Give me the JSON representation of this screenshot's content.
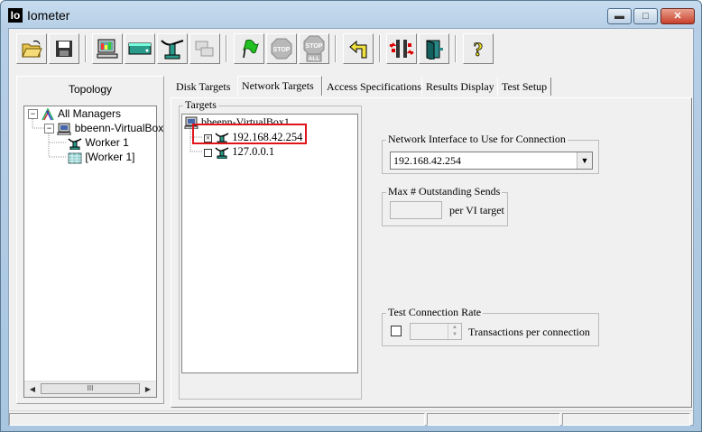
{
  "window": {
    "title": "Iometer",
    "icon_text": "Io",
    "controls": [
      "minimize",
      "maximize",
      "close"
    ]
  },
  "toolbar": {
    "buttons": [
      {
        "icon": "open-folder-icon"
      },
      {
        "icon": "save-disk-icon"
      },
      {
        "icon": "display-icon"
      },
      {
        "icon": "new-disk-worker-icon"
      },
      {
        "icon": "new-network-worker-icon"
      },
      {
        "icon": "duplicate-worker-icon"
      },
      {
        "icon": "start-flag-icon"
      },
      {
        "icon": "stop-icon",
        "text": "STOP"
      },
      {
        "icon": "stop-all-icon",
        "text": "STOP",
        "text2": "ALL"
      },
      {
        "icon": "reset-workers-icon"
      },
      {
        "icon": "disconnect-icon"
      },
      {
        "icon": "exit-icon"
      },
      {
        "icon": "help-icon",
        "text": "?"
      }
    ]
  },
  "topology": {
    "header": "Topology",
    "tree": [
      {
        "label": "All Managers",
        "expander": "−",
        "icon": "all-managers-icon"
      },
      {
        "label": "bbeenn-VirtualBox",
        "expander": "−",
        "icon": "manager-computer-icon"
      },
      {
        "label": "Worker 1",
        "icon": "network-worker-icon"
      },
      {
        "label": "[Worker 1]",
        "icon": "disk-worker-icon"
      }
    ],
    "scroll_thumb": "III"
  },
  "tabs": [
    {
      "label": "Disk Targets"
    },
    {
      "label": "Network Targets",
      "active": true
    },
    {
      "label": "Access Specifications"
    },
    {
      "label": "Results Display"
    },
    {
      "label": "Test Setup"
    }
  ],
  "targets": {
    "group_label": "Targets",
    "root": "bbeenn-VirtualBox1",
    "items": [
      {
        "label": "192.168.42.254",
        "checked": true,
        "highlighted": true
      },
      {
        "label": "127.0.0.1",
        "checked": false
      }
    ]
  },
  "network_interface": {
    "group_label": "Network Interface to Use for Connection",
    "selected": "192.168.42.254"
  },
  "max_outstanding": {
    "group_label": "Max # Outstanding Sends",
    "value": "",
    "unit": "per VI target"
  },
  "test_connection_rate": {
    "group_label": "Test Connection Rate",
    "checked": false,
    "value": "",
    "unit": "Transactions per connection"
  },
  "colors": {
    "highlight": "#e0151b",
    "window_frame": "#b7cfe6",
    "face": "#f0f0f0"
  }
}
